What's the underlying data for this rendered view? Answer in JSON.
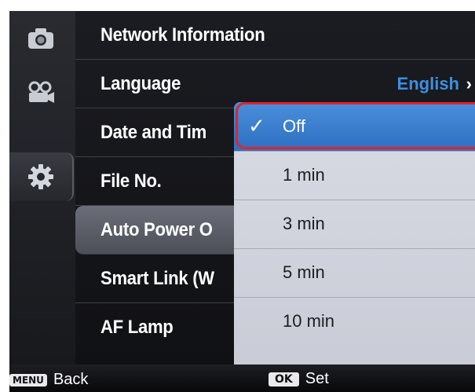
{
  "menu": {
    "items": [
      {
        "label": "Network Information",
        "value": "",
        "chevron": ""
      },
      {
        "label": "Language",
        "value": "English",
        "chevron": "›"
      },
      {
        "label": "Date and Tim",
        "value": "",
        "chevron": ""
      },
      {
        "label": "File No.",
        "value": "",
        "chevron": ""
      },
      {
        "label": "Auto Power O",
        "value": "",
        "chevron": ""
      },
      {
        "label": "Smart Link (W",
        "value": "",
        "chevron": ""
      },
      {
        "label": "AF Lamp",
        "value": "",
        "chevron": ""
      }
    ],
    "selected_index": 4
  },
  "popup": {
    "options": [
      "Off",
      "1 min",
      "3 min",
      "5 min",
      "10 min"
    ],
    "selected_index": 0,
    "check_glyph": "✓"
  },
  "rail": {
    "tabs": [
      "camera-icon",
      "video-camera-icon",
      "gear-icon"
    ],
    "active_index": 2
  },
  "bottom": {
    "menu_key": "MENU",
    "back_label": "Back",
    "ok_key": "OK",
    "set_label": "Set"
  },
  "colors": {
    "accent_blue": "#2d6fc1",
    "value_blue": "#3d8fe0",
    "focus_ring": "#e0242c"
  }
}
